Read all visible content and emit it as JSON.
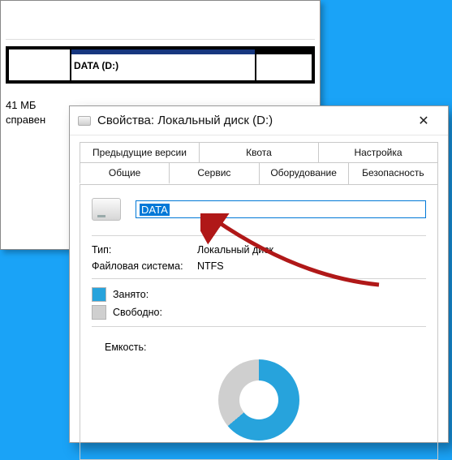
{
  "bg": {
    "partition_label": "DATA  (D:)",
    "size": "41 МБ",
    "status": "справен"
  },
  "dialog": {
    "title": "Свойства: Локальный диск (D:)",
    "tabs_row1": [
      {
        "label": "Предыдущие версии"
      },
      {
        "label": "Квота"
      },
      {
        "label": "Настройка"
      }
    ],
    "tabs_row2": [
      {
        "label": "Общие"
      },
      {
        "label": "Сервис"
      },
      {
        "label": "Оборудование"
      },
      {
        "label": "Безопасность"
      }
    ],
    "volume_name": "DATA",
    "type_label": "Тип:",
    "type_value": "Локальный диск",
    "fs_label": "Файловая система:",
    "fs_value": "NTFS",
    "used_label": "Занято:",
    "free_label": "Свободно:",
    "capacity_label": "Емкость:"
  }
}
